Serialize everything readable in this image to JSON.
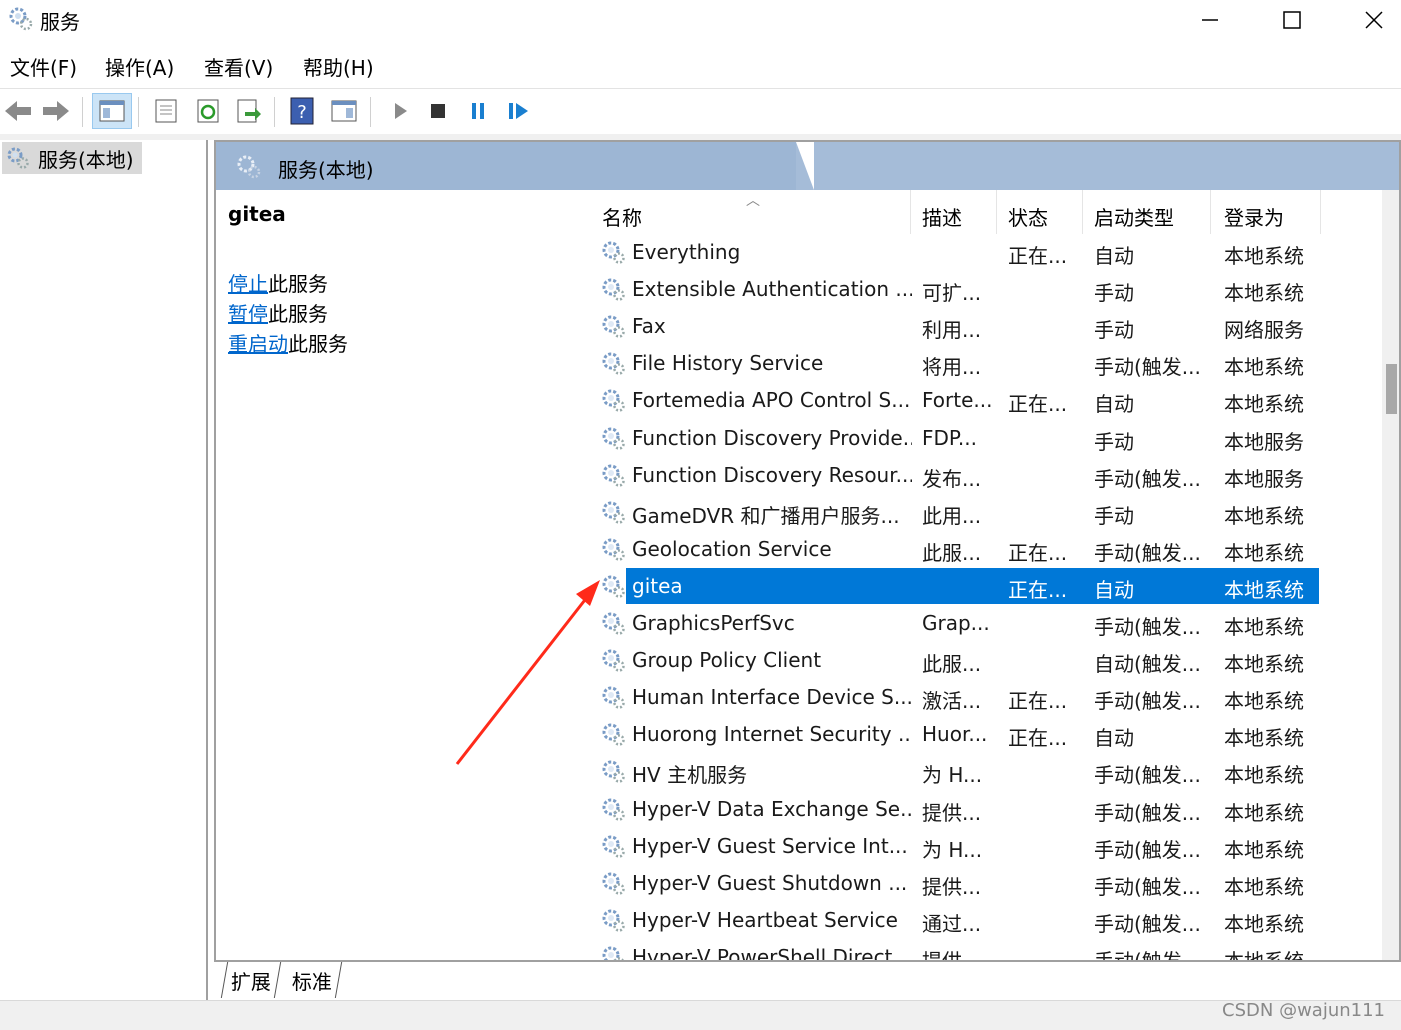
{
  "window": {
    "title": "服务",
    "icon": "gear-icon"
  },
  "menu": [
    "文件(F)",
    "操作(A)",
    "查看(V)",
    "帮助(H)"
  ],
  "tree": {
    "root_label": "服务(本地)"
  },
  "pane": {
    "header": "服务(本地)",
    "selected_service": "gitea",
    "actions": [
      {
        "link": "停止",
        "suffix": "此服务"
      },
      {
        "link": "暂停",
        "suffix": "此服务"
      },
      {
        "link": "重启动",
        "suffix": "此服务"
      }
    ]
  },
  "columns": {
    "name": "名称",
    "desc": "描述",
    "status": "状态",
    "start": "启动类型",
    "logon": "登录为"
  },
  "services": [
    {
      "name": "Everything",
      "desc": "",
      "status": "正在...",
      "start": "自动",
      "logon": "本地系统"
    },
    {
      "name": "Extensible Authentication ...",
      "desc": "可扩...",
      "status": "",
      "start": "手动",
      "logon": "本地系统"
    },
    {
      "name": "Fax",
      "desc": "利用...",
      "status": "",
      "start": "手动",
      "logon": "网络服务"
    },
    {
      "name": "File History Service",
      "desc": "将用...",
      "status": "",
      "start": "手动(触发...",
      "logon": "本地系统"
    },
    {
      "name": "Fortemedia APO Control S...",
      "desc": "Forte...",
      "status": "正在...",
      "start": "自动",
      "logon": "本地系统"
    },
    {
      "name": "Function Discovery Provide...",
      "desc": "FDP...",
      "status": "",
      "start": "手动",
      "logon": "本地服务"
    },
    {
      "name": "Function Discovery Resour...",
      "desc": "发布...",
      "status": "",
      "start": "手动(触发...",
      "logon": "本地服务"
    },
    {
      "name": "GameDVR 和广播用户服务...",
      "desc": "此用...",
      "status": "",
      "start": "手动",
      "logon": "本地系统"
    },
    {
      "name": "Geolocation Service",
      "desc": "此服...",
      "status": "正在...",
      "start": "手动(触发...",
      "logon": "本地系统"
    },
    {
      "name": "gitea",
      "desc": "",
      "status": "正在...",
      "start": "自动",
      "logon": "本地系统",
      "selected": true
    },
    {
      "name": "GraphicsPerfSvc",
      "desc": "Grap...",
      "status": "",
      "start": "手动(触发...",
      "logon": "本地系统"
    },
    {
      "name": "Group Policy Client",
      "desc": "此服...",
      "status": "",
      "start": "自动(触发...",
      "logon": "本地系统"
    },
    {
      "name": "Human Interface Device S...",
      "desc": "激活...",
      "status": "正在...",
      "start": "手动(触发...",
      "logon": "本地系统"
    },
    {
      "name": "Huorong Internet Security ...",
      "desc": "Huor...",
      "status": "正在...",
      "start": "自动",
      "logon": "本地系统"
    },
    {
      "name": "HV 主机服务",
      "desc": "为 H...",
      "status": "",
      "start": "手动(触发...",
      "logon": "本地系统"
    },
    {
      "name": "Hyper-V Data Exchange Se...",
      "desc": "提供...",
      "status": "",
      "start": "手动(触发...",
      "logon": "本地系统"
    },
    {
      "name": "Hyper-V Guest Service Int...",
      "desc": "为 H...",
      "status": "",
      "start": "手动(触发...",
      "logon": "本地系统"
    },
    {
      "name": "Hyper-V Guest Shutdown ...",
      "desc": "提供...",
      "status": "",
      "start": "手动(触发...",
      "logon": "本地系统"
    },
    {
      "name": "Hyper-V Heartbeat Service",
      "desc": "通过...",
      "status": "",
      "start": "手动(触发...",
      "logon": "本地系统"
    },
    {
      "name": "Hyper-V PowerShell Direct ...",
      "desc": "提供...",
      "status": "",
      "start": "手动(触发...",
      "logon": "本地系统"
    }
  ],
  "bottom_tabs": [
    "扩展",
    "标准"
  ],
  "watermark": "CSDN @wajun111",
  "colors": {
    "selection": "#0078d7",
    "header": "#9db6d4",
    "link": "#0066cc",
    "annotation_arrow": "#ff2a1a"
  }
}
